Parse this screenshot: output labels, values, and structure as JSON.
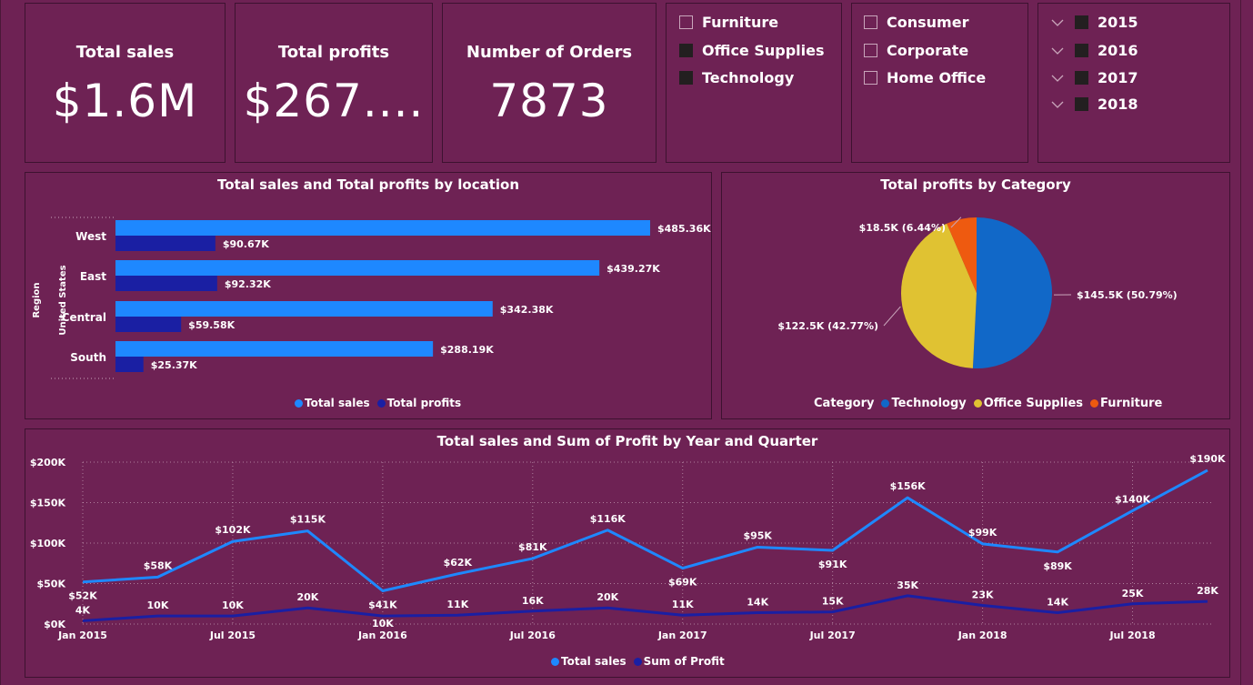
{
  "kpis": [
    {
      "label": "Total sales",
      "value": "$1.6M"
    },
    {
      "label": "Total profits",
      "value": "$267...."
    },
    {
      "label": "Number of Orders",
      "value": "7873"
    }
  ],
  "category_slicer": {
    "items": [
      {
        "label": "Furniture",
        "checked": false
      },
      {
        "label": "Office Supplies",
        "checked": true
      },
      {
        "label": "Technology",
        "checked": true
      }
    ]
  },
  "segment_slicer": {
    "items": [
      {
        "label": "Consumer",
        "checked": false
      },
      {
        "label": "Corporate",
        "checked": false
      },
      {
        "label": "Home Office",
        "checked": false
      }
    ]
  },
  "year_slicer": {
    "items": [
      {
        "label": "2015",
        "checked": true
      },
      {
        "label": "2016",
        "checked": true
      },
      {
        "label": "2017",
        "checked": true
      },
      {
        "label": "2018",
        "checked": true
      }
    ]
  },
  "colors": {
    "sales": "#1e88ff",
    "profits": "#1a1fa3",
    "technology": "#1168c8",
    "office_supplies": "#e0c232",
    "furniture": "#ee5a10"
  },
  "chart_data": [
    {
      "type": "bar",
      "title": "Total sales and Total profits by location",
      "axis_title": "Region",
      "group_label": "United States",
      "categories": [
        "West",
        "East",
        "Central",
        "South"
      ],
      "series": [
        {
          "name": "Total sales",
          "values": [
            485.36,
            439.27,
            342.38,
            288.19
          ],
          "labels": [
            "$485.36K",
            "$439.27K",
            "$342.38K",
            "$288.19K"
          ]
        },
        {
          "name": "Total profits",
          "values": [
            90.67,
            92.32,
            59.58,
            25.37
          ],
          "labels": [
            "$90.67K",
            "$92.32K",
            "$59.58K",
            "$25.37K"
          ]
        }
      ],
      "legend": [
        "Total sales",
        "Total profits"
      ]
    },
    {
      "type": "pie",
      "title": "Total profits by Category",
      "legend_title": "Category",
      "slices": [
        {
          "name": "Technology",
          "value": 145.5,
          "label": "$145.5K (50.79%)"
        },
        {
          "name": "Office Supplies",
          "value": 122.5,
          "label": "$122.5K (42.77%)"
        },
        {
          "name": "Furniture",
          "value": 18.5,
          "label": "$18.5K (6.44%)"
        }
      ]
    },
    {
      "type": "line",
      "title": "Total sales and Sum of Profit by Year and Quarter",
      "x_ticks": [
        "Jan 2015",
        "Jul 2015",
        "Jan 2016",
        "Jul 2016",
        "Jan 2017",
        "Jul 2017",
        "Jan 2018",
        "Jul 2018"
      ],
      "y_ticks": [
        "$0K",
        "$50K",
        "$100K",
        "$150K",
        "$200K"
      ],
      "ylim": [
        0,
        200
      ],
      "series": [
        {
          "name": "Total sales",
          "values": [
            52,
            58,
            102,
            115,
            41,
            62,
            81,
            116,
            69,
            95,
            91,
            156,
            99,
            89,
            140,
            190
          ],
          "labels": [
            "$52K",
            "$58K",
            "$102K",
            "$115K",
            "$41K",
            "$62K",
            "$81K",
            "$116K",
            "$69K",
            "$95K",
            "$91K",
            "$156K",
            "$99K",
            "$89K",
            "$140K",
            "$190K"
          ]
        },
        {
          "name": "Sum of Profit",
          "values": [
            4,
            10,
            10,
            20,
            10,
            11,
            16,
            20,
            11,
            14,
            15,
            35,
            23,
            14,
            25,
            28
          ],
          "labels": [
            "4K",
            "10K",
            "10K",
            "20K",
            "10K",
            "11K",
            "16K",
            "20K",
            "11K",
            "14K",
            "15K",
            "35K",
            "23K",
            "14K",
            "25K",
            "28K"
          ]
        }
      ]
    }
  ]
}
